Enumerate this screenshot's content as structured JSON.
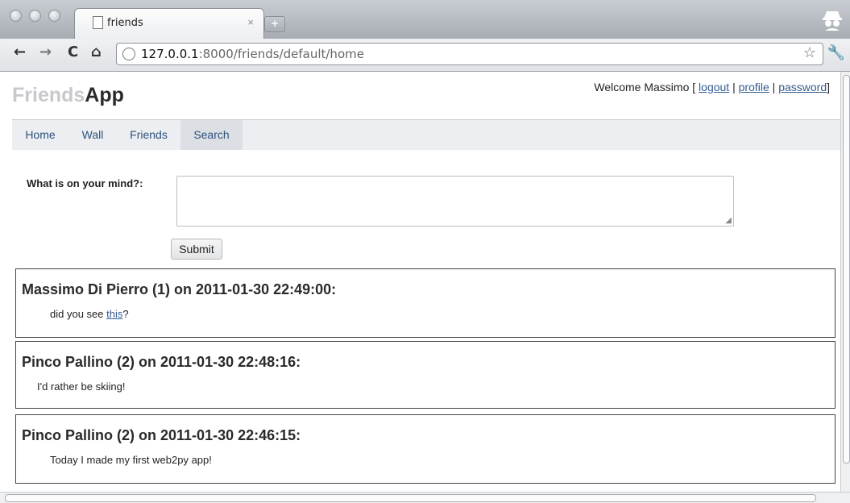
{
  "browser": {
    "tab_title": "friends",
    "tab_close": "×",
    "new_tab": "+",
    "url_host": "127.0.0.1",
    "url_rest": ":8000/friends/default/home",
    "back": "←",
    "forward": "→",
    "reload": "C",
    "home": "⌂",
    "star": "☆",
    "wrench": "🔧"
  },
  "header": {
    "logo_light": "Friends",
    "logo_dark": "App",
    "welcome_prefix": "Welcome Massimo [ ",
    "logout": "logout",
    "sep1": " | ",
    "profile": "profile",
    "sep2": " | ",
    "password": "password",
    "welcome_suffix": "]"
  },
  "menu": {
    "items": [
      "Home",
      "Wall",
      "Friends",
      "Search"
    ]
  },
  "form": {
    "label": "What is on your mind?:",
    "textarea_value": "",
    "submit": "Submit"
  },
  "posts": [
    {
      "title": "Massimo Di Pierro (1) on 2011-01-30 22:49:00:",
      "body_before": "did you see ",
      "link": "this",
      "body_after": "?"
    },
    {
      "title": "Pinco Pallino (2) on 2011-01-30 22:48:16:",
      "body": "I'd rather be skiing!"
    },
    {
      "title": "Pinco Pallino (2) on 2011-01-30 22:46:15:",
      "body": "Today I made my first web2py app!"
    }
  ]
}
